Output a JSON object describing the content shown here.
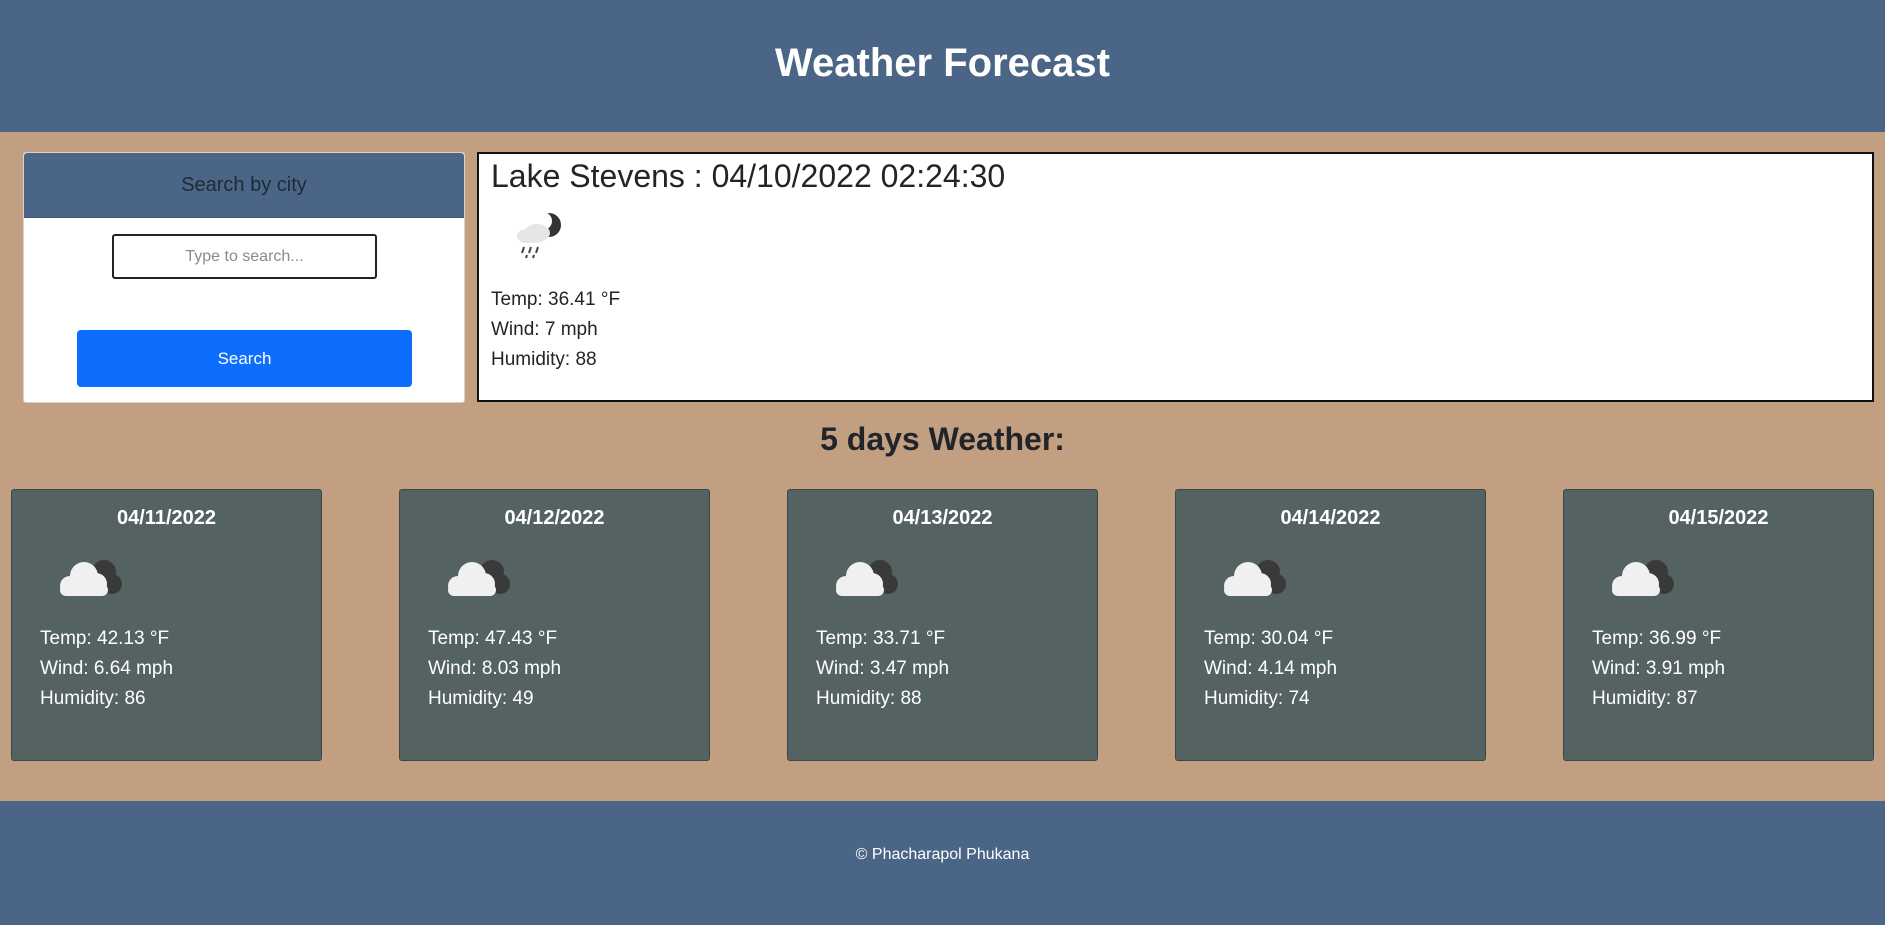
{
  "header": {
    "title": "Weather Forecast"
  },
  "search": {
    "heading": "Search by city",
    "placeholder": "Type to search...",
    "button_label": "Search"
  },
  "current": {
    "title": "Lake Stevens : 04/10/2022 02:24:30",
    "icon": "rain-night-icon",
    "temp": "Temp: 36.41 °F",
    "wind": "Wind: 7 mph",
    "humidity": "Humidity: 88"
  },
  "forecast_heading": "5 days Weather:",
  "forecast": [
    {
      "date": "04/11/2022",
      "icon": "cloudy-icon",
      "temp": "Temp: 42.13 °F",
      "wind": "Wind: 6.64 mph",
      "humidity": "Humidity: 86"
    },
    {
      "date": "04/12/2022",
      "icon": "cloudy-icon",
      "temp": "Temp: 47.43 °F",
      "wind": "Wind: 8.03 mph",
      "humidity": "Humidity: 49"
    },
    {
      "date": "04/13/2022",
      "icon": "cloudy-icon",
      "temp": "Temp: 33.71 °F",
      "wind": "Wind: 3.47 mph",
      "humidity": "Humidity: 88"
    },
    {
      "date": "04/14/2022",
      "icon": "cloudy-icon",
      "temp": "Temp: 30.04 °F",
      "wind": "Wind: 4.14 mph",
      "humidity": "Humidity: 74"
    },
    {
      "date": "04/15/2022",
      "icon": "cloudy-icon",
      "temp": "Temp: 36.99 °F",
      "wind": "Wind: 3.91 mph",
      "humidity": "Humidity: 87"
    }
  ],
  "footer": {
    "text": "© Phacharapol Phukana"
  },
  "colors": {
    "header_bg": "#4a6585",
    "page_bg": "#c19f80",
    "card_bg": "#556262",
    "button_bg": "#0d6efd"
  }
}
